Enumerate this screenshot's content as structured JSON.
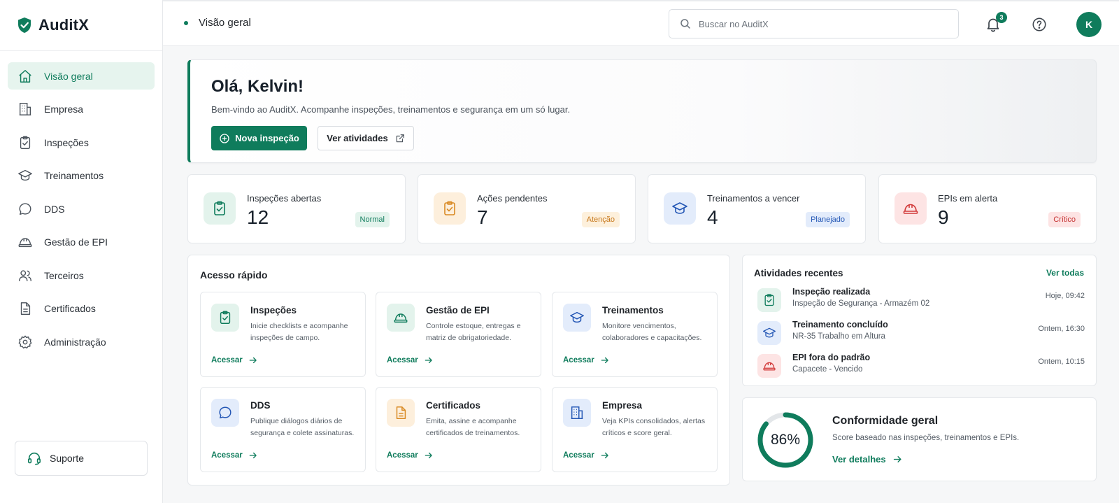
{
  "brand": {
    "name": "AuditX",
    "accent": "#0f7c5c"
  },
  "sidebar": {
    "items": [
      {
        "label": "Visão geral",
        "icon": "home-icon"
      },
      {
        "label": "Empresa",
        "icon": "building-icon"
      },
      {
        "label": "Inspeções",
        "icon": "clipboard-check-icon"
      },
      {
        "label": "Treinamentos",
        "icon": "graduation-cap-icon"
      },
      {
        "label": "DDS",
        "icon": "chat-bubble-icon"
      },
      {
        "label": "Gestão de EPI",
        "icon": "hard-hat-icon"
      },
      {
        "label": "Terceiros",
        "icon": "users-icon"
      },
      {
        "label": "Certificados",
        "icon": "document-icon"
      },
      {
        "label": "Administração",
        "icon": "gear-icon"
      }
    ],
    "active_index": 0,
    "support_label": "Suporte"
  },
  "topbar": {
    "breadcrumb": "Visão geral",
    "search_placeholder": "Buscar no AuditX",
    "notifications_count": "3",
    "avatar_initial": "K"
  },
  "hero": {
    "greeting": "Olá, Kelvin!",
    "subtitle": "Bem-vindo ao AuditX. Acompanhe inspeções, treinamentos e segurança em um só lugar.",
    "primary_button": "Nova inspeção",
    "secondary_button": "Ver atividades"
  },
  "stats": [
    {
      "label": "Inspeções abertas",
      "value": "12",
      "tag": "Normal",
      "tag_color": "#0f7c5c",
      "tag_bg": "#e3f3ec",
      "icon": "clipboard-check-icon",
      "icon_color": "#0f7c5c",
      "icon_bg": "#e3f3ec"
    },
    {
      "label": "Ações pendentes",
      "value": "7",
      "tag": "Atenção",
      "tag_color": "#c7771a",
      "tag_bg": "#fdf0dc",
      "icon": "clipboard-check-icon",
      "icon_color": "#d98a23",
      "icon_bg": "#fdefdc"
    },
    {
      "label": "Treinamentos a vencer",
      "value": "4",
      "tag": "Planejado",
      "tag_color": "#2457b5",
      "tag_bg": "#e3ecfb",
      "icon": "graduation-cap-icon",
      "icon_color": "#2457b5",
      "icon_bg": "#e3ecfb"
    },
    {
      "label": "EPIs em alerta",
      "value": "9",
      "tag": "Crítico",
      "tag_color": "#c53030",
      "tag_bg": "#fde4e4",
      "icon": "hard-hat-icon",
      "icon_color": "#d23b3b",
      "icon_bg": "#fde4e4"
    }
  ],
  "quick_access": {
    "title": "Acesso rápido",
    "action_label": "Acessar",
    "cards": [
      {
        "title": "Inspeções",
        "desc": "Inicie checklists e acompanhe inspeções de campo.",
        "icon": "clipboard-check-icon",
        "icon_color": "#0f7c5c",
        "icon_bg": "#e3f3ec"
      },
      {
        "title": "Gestão de EPI",
        "desc": "Controle estoque, entregas e matriz de obrigatoriedade.",
        "icon": "hard-hat-icon",
        "icon_color": "#0f7c5c",
        "icon_bg": "#e3f3ec"
      },
      {
        "title": "Treinamentos",
        "desc": "Monitore vencimentos, colaboradores e capacitações.",
        "icon": "graduation-cap-icon",
        "icon_color": "#2457b5",
        "icon_bg": "#e3ecfb"
      },
      {
        "title": "DDS",
        "desc": "Publique diálogos diários de segurança e colete assinaturas.",
        "icon": "chat-bubble-icon",
        "icon_color": "#2457b5",
        "icon_bg": "#e3ecfb"
      },
      {
        "title": "Certificados",
        "desc": "Emita, assine e acompanhe certificados de treinamentos.",
        "icon": "document-icon",
        "icon_color": "#d98a23",
        "icon_bg": "#fdefdc"
      },
      {
        "title": "Empresa",
        "desc": "Veja KPIs consolidados, alertas críticos e score geral.",
        "icon": "building-icon",
        "icon_color": "#2457b5",
        "icon_bg": "#e3ecfb"
      }
    ]
  },
  "activities": {
    "title": "Atividades recentes",
    "view_all": "Ver todas",
    "items": [
      {
        "title": "Inspeção realizada",
        "subtitle": "Inspeção de Segurança - Armazém 02",
        "time": "Hoje, 09:42",
        "icon": "clipboard-check-icon",
        "icon_color": "#0f7c5c",
        "icon_bg": "#e3f3ec"
      },
      {
        "title": "Treinamento concluído",
        "subtitle": "NR-35 Trabalho em Altura",
        "time": "Ontem, 16:30",
        "icon": "graduation-cap-icon",
        "icon_color": "#2457b5",
        "icon_bg": "#e3ecfb"
      },
      {
        "title": "EPI fora do padrão",
        "subtitle": "Capacete - Vencido",
        "time": "Ontem, 10:15",
        "icon": "hard-hat-icon",
        "icon_color": "#d23b3b",
        "icon_bg": "#fde4e4"
      }
    ]
  },
  "compliance": {
    "title": "Conformidade geral",
    "percent_label": "86%",
    "percent": 0.86,
    "description": "Score baseado nas inspeções, treinamentos e EPIs.",
    "link": "Ver detalhes"
  }
}
